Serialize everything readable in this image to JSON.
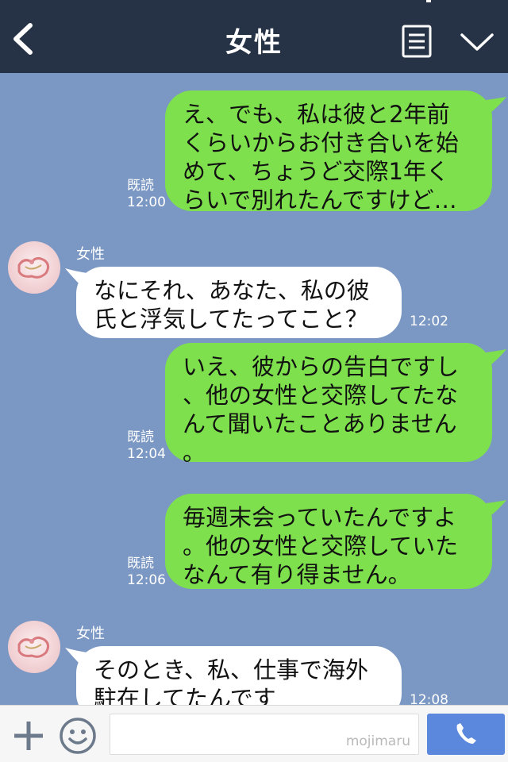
{
  "header": {
    "title": "女性",
    "icons": {
      "back": "chevron-left-icon",
      "menu": "menu-list-icon",
      "expand": "chevron-down-icon"
    }
  },
  "messages": [
    {
      "side": "out",
      "lines": [
        "え、でも、私は彼と2年前",
        "くらいからお付き合いを始",
        "めて、ちょうど交際1年く",
        "らいで別れたんですけど…"
      ],
      "read": "既読",
      "time": "12:00"
    },
    {
      "side": "in",
      "sender": "女性",
      "lines": [
        "なにそれ、あなた、私の彼",
        "氏と浮気してたってこと？"
      ],
      "time": "12:02"
    },
    {
      "side": "out",
      "lines": [
        "いえ、彼からの告白ですし",
        "、他の女性と交際してたな",
        "んて聞いたことありません",
        "。"
      ],
      "read": "既読",
      "time": "12:04"
    },
    {
      "side": "out",
      "lines": [
        "毎週末会っていたんですよ",
        "。他の女性と交際していた",
        "なんて有り得ません。"
      ],
      "read": "既読",
      "time": "12:06"
    },
    {
      "side": "in",
      "sender": "女性",
      "lines": [
        "そのとき、私、仕事で海外",
        "駐在してたんです"
      ],
      "time": "12:08"
    }
  ],
  "input_bar": {
    "placeholder": "",
    "watermark": "mojimaru",
    "icons": {
      "add": "plus-icon",
      "emoji": "smiley-icon",
      "call": "phone-icon"
    }
  },
  "colors": {
    "header_bg": "#263245",
    "chat_bg": "#7b97c3",
    "outgoing_bubble": "#7fe04e",
    "incoming_bubble": "#ffffff",
    "call_button": "#5b87dd"
  }
}
